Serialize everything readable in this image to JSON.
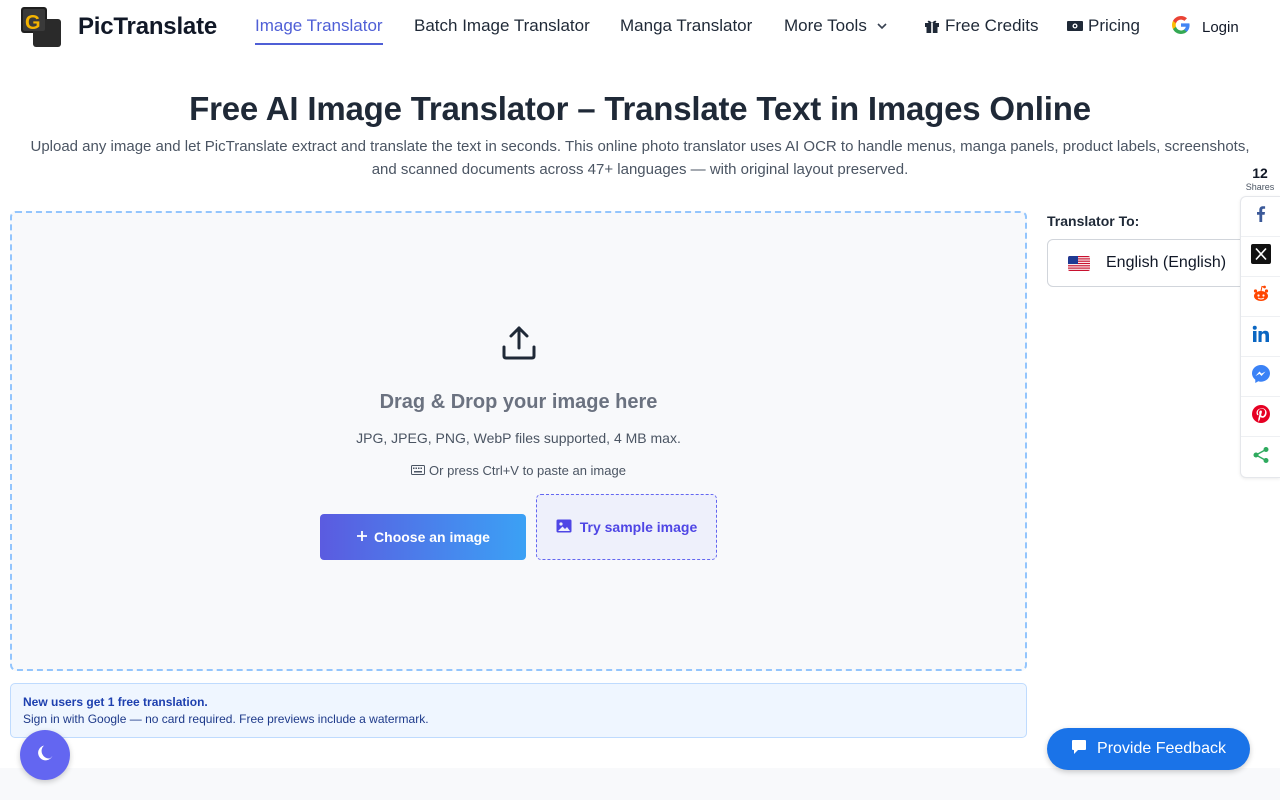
{
  "brand": {
    "name": "PicTranslate"
  },
  "nav": {
    "items": [
      {
        "label": "Image Translator"
      },
      {
        "label": "Batch Image Translator"
      },
      {
        "label": "Manga Translator"
      },
      {
        "label": "More Tools"
      },
      {
        "label": "Free Credits"
      },
      {
        "label": "Pricing"
      }
    ],
    "login": "Login"
  },
  "hero": {
    "title": "Free AI Image Translator – Translate Text in Images Online",
    "description": "Upload any image and let PicTranslate extract and translate the text in seconds. This online photo translator uses AI OCR to handle menus, manga panels, product labels, screenshots, and scanned documents across 47+ languages — with original layout preserved."
  },
  "upload": {
    "title": "Drag & Drop your image here",
    "formats": "JPG, JPEG, PNG, WebP files supported, 4 MB max.",
    "paste_hint": "Or press Ctrl+V to paste an image",
    "choose_label": "Choose an image",
    "sample_label": "Try sample image"
  },
  "translator": {
    "label": "Translator To:",
    "selected_language": "English (English)"
  },
  "share": {
    "count": "12",
    "label": "Shares"
  },
  "notice": {
    "title": "New users get 1 free translation.",
    "text": "Sign in with Google — no card required. Free previews include a watermark."
  },
  "feedback": {
    "label": "Provide Feedback"
  },
  "colors": {
    "accent": "#4f5fd6",
    "dropzone_border": "#93c5fd",
    "feedback_bg": "#1a73e8",
    "dark_toggle_bg": "#6366f1"
  }
}
